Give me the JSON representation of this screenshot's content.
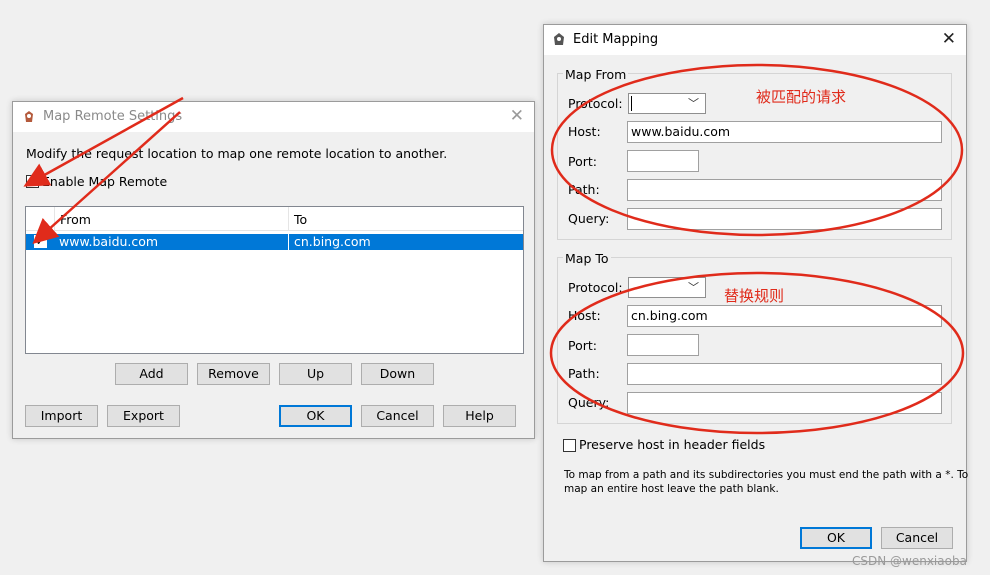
{
  "map_remote": {
    "title": "Map Remote Settings",
    "description": "Modify the request location to map one remote location to another.",
    "enable_label": "Enable Map Remote",
    "enable_checked": true,
    "columns": {
      "from": "From",
      "to": "To"
    },
    "rows": [
      {
        "checked": true,
        "from": "www.baidu.com",
        "to": "cn.bing.com",
        "selected": true
      }
    ],
    "buttons": {
      "add": "Add",
      "remove": "Remove",
      "up": "Up",
      "down": "Down",
      "import": "Import",
      "export": "Export",
      "ok": "OK",
      "cancel": "Cancel",
      "help": "Help"
    }
  },
  "edit_mapping": {
    "title": "Edit Mapping",
    "map_from": {
      "group_title": "Map From",
      "protocol_label": "Protocol:",
      "protocol_value": "",
      "host_label": "Host:",
      "host_value": "www.baidu.com",
      "port_label": "Port:",
      "port_value": "",
      "path_label": "Path:",
      "path_value": "",
      "query_label": "Query:",
      "query_value": ""
    },
    "map_to": {
      "group_title": "Map To",
      "protocol_label": "Protocol:",
      "protocol_value": "",
      "host_label": "Host:",
      "host_value": "cn.bing.com",
      "port_label": "Port:",
      "port_value": "",
      "path_label": "Path:",
      "path_value": "",
      "query_label": "Query:",
      "query_value": ""
    },
    "preserve_host_label": "Preserve host in header fields",
    "preserve_host_checked": false,
    "help_text_1": "To map from a path and its subdirectories you must end the path with a *. To",
    "help_text_2": "map an entire host leave the path blank.",
    "buttons": {
      "ok": "OK",
      "cancel": "Cancel"
    }
  },
  "annotations": {
    "from_note": "被匹配的请求",
    "to_note": "替换规则",
    "color": "#e02b1b"
  },
  "watermark": "CSDN @wenxiaoba"
}
